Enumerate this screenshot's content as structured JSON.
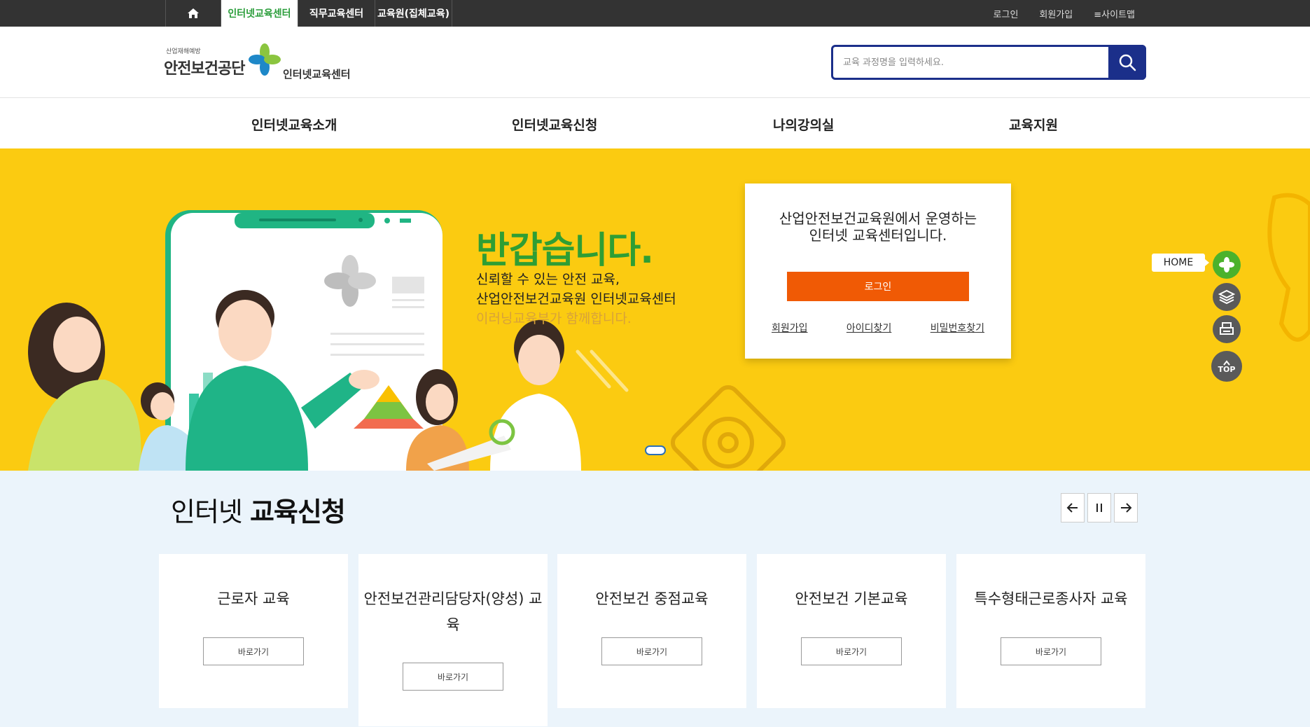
{
  "topbar": {
    "home_icon": "home-icon",
    "tabs": [
      "인터넷교육센터",
      "직무교육센터",
      "교육원(집체교육)"
    ],
    "util_links": [
      "로그인",
      "회원가입",
      "≡사이트맵"
    ],
    "colors": {
      "bar": "#333333",
      "active_text": "#2a9d3a"
    }
  },
  "header": {
    "logo_small": "산업재해예방",
    "logo_org": "안전보건공단",
    "logo_sub": "인터넷교육센터",
    "search_placeholder": "교육 과정명을 입력하세요.",
    "search_icon": "search-icon",
    "colors": {
      "search": "#1b2f8a"
    }
  },
  "gnb": [
    "인터넷교육소개",
    "인터넷교육신청",
    "나의강의실",
    "교육지원"
  ],
  "hero": {
    "greeting": "반갑습니다.",
    "lines": [
      "신뢰할 수 있는 안전 교육,",
      "산업안전보건교육원 인터넷교육센터",
      "이러닝교육부가 함께합니다."
    ],
    "colors": {
      "background": "#fbcb11",
      "greeting": "#2f9e34"
    }
  },
  "login_box": {
    "lines": [
      "산업안전보건교육원에서 운영하는",
      "인터넷 교육센터입니다."
    ],
    "login_label": "로그인",
    "links": [
      "회원가입",
      "아이디찾기",
      "비밀번호찾기"
    ],
    "colors": {
      "button": "#f05a05"
    }
  },
  "quick_menu": {
    "home_label": "HOME",
    "icons": [
      "plus-logo-icon",
      "layers-icon",
      "print-icon",
      "chevron-up-icon"
    ],
    "top_label": "TOP"
  },
  "apply": {
    "title_light": "인터넷 ",
    "title_bold": "교육신청",
    "controls": [
      "arrow-left-icon",
      "pause-icon",
      "arrow-right-icon"
    ],
    "cards": [
      {
        "title": "근로자 교육",
        "button": "바로가기"
      },
      {
        "title": "안전보건관리담당자(양성) 교육",
        "button": "바로가기"
      },
      {
        "title": "안전보건 중점교육",
        "button": "바로가기"
      },
      {
        "title": "안전보건 기본교육",
        "button": "바로가기"
      },
      {
        "title": "특수형태근로종사자 교육",
        "button": "바로가기"
      }
    ],
    "colors": {
      "background": "#ebf4fb"
    }
  }
}
